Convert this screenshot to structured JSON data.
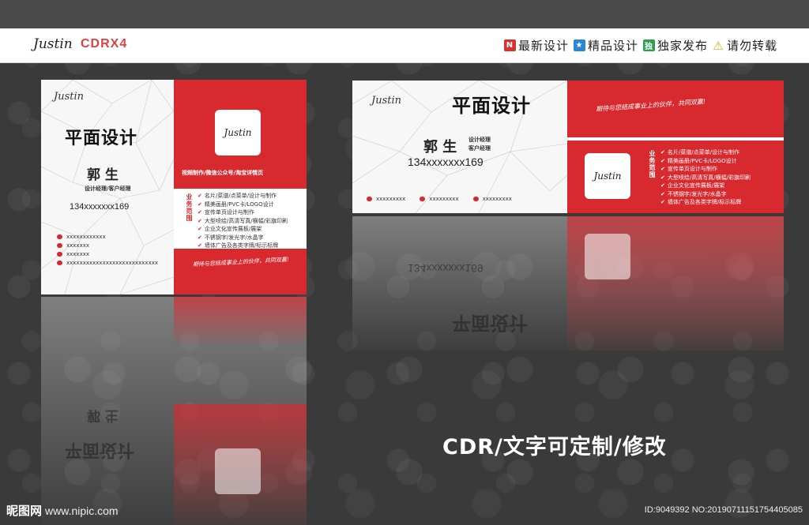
{
  "header": {
    "brand_script": "Justin",
    "brand_version": "CDRX4",
    "tags": [
      {
        "icon": "new-icon",
        "glyph": "N",
        "label": "最新设计"
      },
      {
        "icon": "star-icon",
        "glyph": "★",
        "label": "精品设计"
      },
      {
        "icon": "exclusive-icon",
        "glyph": "独",
        "label": "独家发布"
      },
      {
        "icon": "warning-icon",
        "glyph": "⚠",
        "label": "请勿转载"
      }
    ]
  },
  "vertical_card": {
    "script_name": "Justin",
    "title": "平面设计",
    "name": "郭 生",
    "position": "设计经理/客户经理",
    "phone": "134xxxxxxx169",
    "contacts": [
      "xxxxxxxxxxxx",
      "xxxxxxx",
      "xxxxxxx",
      "xxxxxxxxxxxxxxxxxxxxxxxxxxxx"
    ],
    "logo_text": "Justin",
    "tagline": "视频制作/微信公众号/淘宝详情页",
    "services_label": "业务范围",
    "services": [
      "名片/菜谱/点菜单/设计与制作",
      "精美画册/PVC卡/LOGO设计",
      "宣传单页设计与制作",
      "大型喷绘/高清写真/横幅/彩旗印刷",
      "企业文化宣传展板/展架",
      "不锈钢字/发光字/水晶字",
      "墙体广告及各类字牌/标示标牌"
    ],
    "slogan": "期待与您结成事业上的伙伴，共同双赢!"
  },
  "horizontal_card": {
    "script_name": "Justin",
    "title": "平面设计",
    "name": "郭 生",
    "position_line1": "设计经理",
    "position_line2": "客户经理",
    "phone": "134xxxxxxx169",
    "contacts": [
      "xxxxxxxxx",
      "xxxxxxxxx",
      "xxxxxxxxx"
    ],
    "slogan": "期待与您结成事业上的伙伴，共同双赢!",
    "logo_text": "Justin",
    "services_label": "业务范围",
    "services": [
      "名片/菜谱/点菜单/设计与制作",
      "精美画册/PVC卡/LOGO设计",
      "宣传单页设计与制作",
      "大型喷绘/高清写真/横幅/彩旗印刷",
      "企业文化宣传展板/展架",
      "不锈钢字/发光字/水晶字",
      "墙体广告及各类字牌/标示标牌"
    ]
  },
  "caption": "CDR/文字可定制/修改",
  "watermark": {
    "site_name": "昵图网",
    "site_url": "www.nipic.com",
    "id_text": "ID:9049392 NO:20190711151754405085"
  },
  "colors": {
    "accent_red": "#d8292f",
    "background": "#3a3a3a"
  }
}
